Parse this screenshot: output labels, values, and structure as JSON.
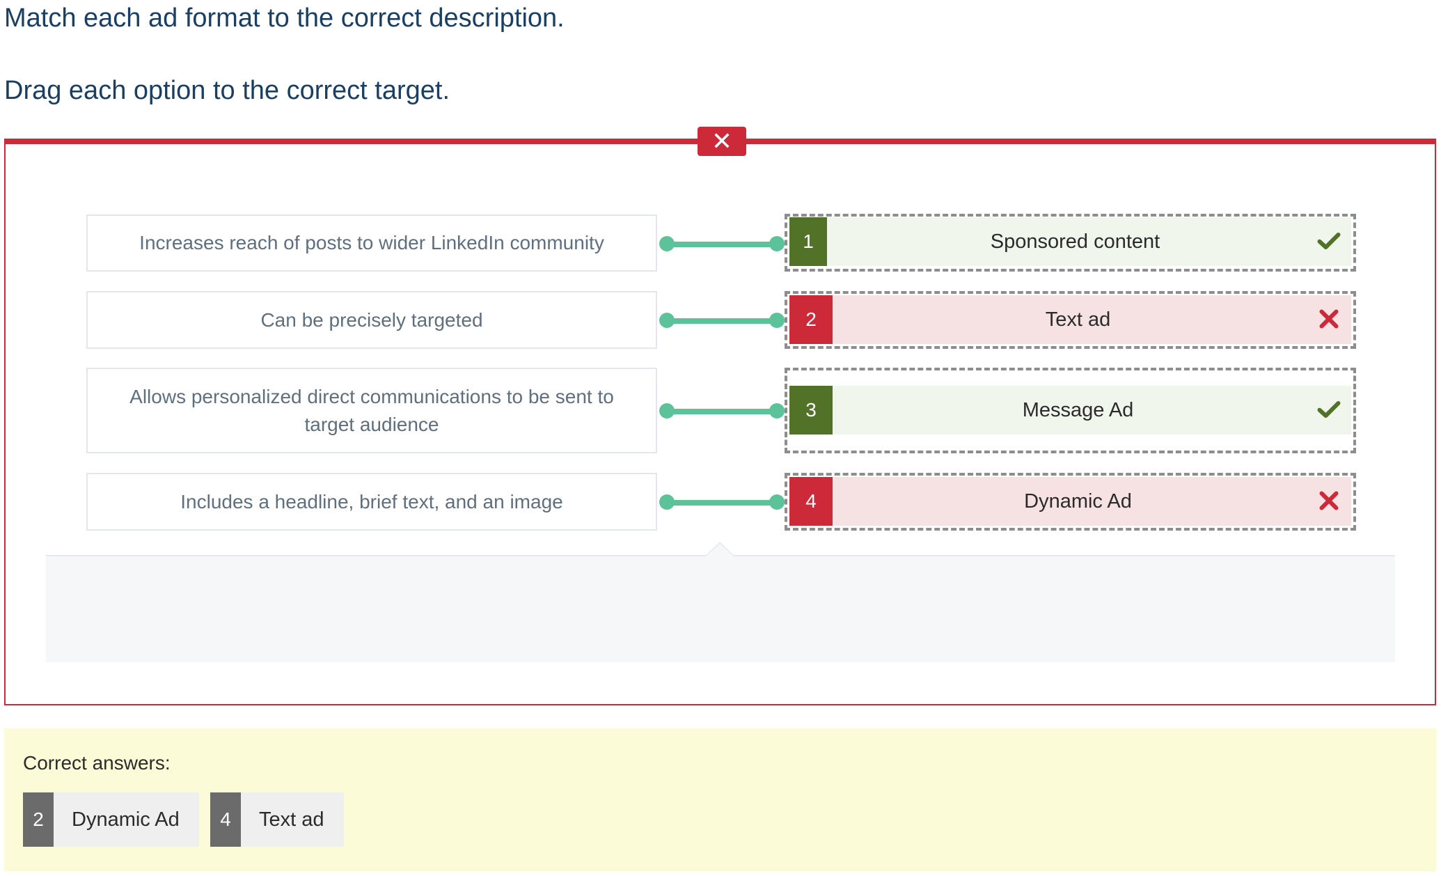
{
  "question": {
    "title": "Match each ad format to the correct description.",
    "instruction": "Drag each option to the correct target."
  },
  "feedback": {
    "status": "incorrect",
    "badge_icon": "close-icon",
    "badge_glyph": "✕",
    "color_incorrect": "#cc2a39",
    "color_correct": "#527227",
    "connector_color": "#5cc29a"
  },
  "pairs": [
    {
      "description": "Increases reach of posts to wider LinkedIn community",
      "answer_number": "1",
      "answer_label": "Sponsored content",
      "result": "correct",
      "result_icon": "checkmark-icon"
    },
    {
      "description": "Can be precisely targeted",
      "answer_number": "2",
      "answer_label": "Text ad",
      "result": "incorrect",
      "result_icon": "cross-icon"
    },
    {
      "description": "Allows personalized direct communications to be sent to target audience",
      "answer_number": "3",
      "answer_label": "Message Ad",
      "result": "correct",
      "result_icon": "checkmark-icon"
    },
    {
      "description": "Includes a headline, brief text, and an image",
      "answer_number": "4",
      "answer_label": "Dynamic Ad",
      "result": "incorrect",
      "result_icon": "cross-icon"
    }
  ],
  "correct_answers": {
    "title": "Correct answers:",
    "items": [
      {
        "number": "2",
        "label": "Dynamic Ad"
      },
      {
        "number": "4",
        "label": "Text ad"
      }
    ]
  }
}
